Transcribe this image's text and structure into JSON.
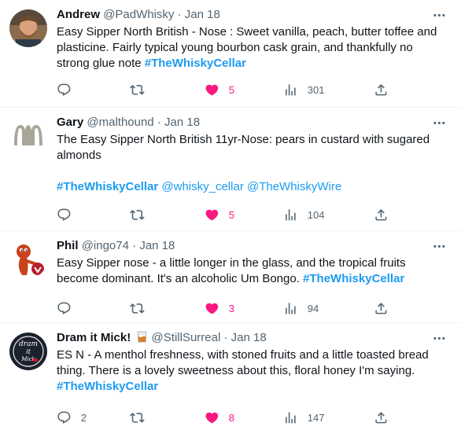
{
  "tweets": [
    {
      "name": "Andrew",
      "handle": "@PadWhisky",
      "dot": "·",
      "date": "Jan 18",
      "text": "Easy Sipper North British - Nose : Sweet vanilla, peach, butter toffee and plasticine. Fairly typical young bourbon cask grain, and thankfully no strong glue note",
      "hashtag": "#TheWhiskyCellar",
      "replies": "",
      "retweets": "",
      "likes": "5",
      "views": "301"
    },
    {
      "name": "Gary",
      "handle": "@malthound",
      "dot": "·",
      "date": "Jan 18",
      "text": "The Easy Sipper North British 11yr-Nose: pears in custard with sugared almonds",
      "hashtag": "#TheWhiskyCellar",
      "mention1": "@whisky_cellar",
      "mention2": "@TheWhiskyWire",
      "replies": "",
      "retweets": "",
      "likes": "5",
      "views": "104"
    },
    {
      "name": "Phil",
      "handle": "@ingo74",
      "dot": "·",
      "date": "Jan 18",
      "text": "Easy Sipper nose - a little longer in the glass, and the tropical fruits become dominant. It's an alcoholic Um Bongo.",
      "hashtag": "#TheWhiskyCellar",
      "replies": "",
      "retweets": "",
      "likes": "3",
      "views": "94"
    },
    {
      "name": "Dram it Mick!",
      "handle": "@StillSurreal",
      "dot": "·",
      "date": "Jan 18",
      "emoji": "whisky-glass",
      "text": "ES N - A menthol freshness, with stoned fruits and a little toasted bread thing. There is a lovely sweetness about this, floral honey I'm saying.",
      "hashtag": "#TheWhiskyCellar",
      "replies": "2",
      "retweets": "",
      "likes": "8",
      "views": "147",
      "avatar_text_top": "dram",
      "avatar_text_mid": "it",
      "avatar_text_bottom": "Mick"
    }
  ],
  "colors": {
    "link": "#1d9bf0",
    "like": "#f91880",
    "muted": "#536471",
    "text": "#0f1419"
  },
  "icons": [
    "more-icon",
    "reply-icon",
    "retweet-icon",
    "heart-icon",
    "views-icon",
    "share-icon"
  ]
}
